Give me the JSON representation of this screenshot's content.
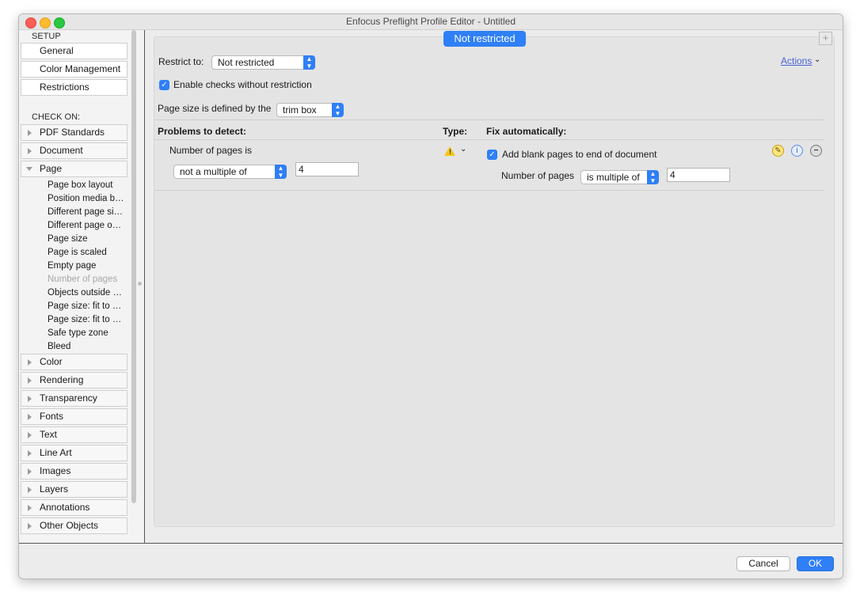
{
  "window": {
    "title": "Enfocus Preflight Profile Editor - Untitled"
  },
  "sidebar": {
    "setup_heading": "SETUP",
    "setup_items": [
      "General",
      "Color Management",
      "Restrictions"
    ],
    "check_on_heading": "CHECK ON:",
    "groups_top": [
      "PDF Standards",
      "Document",
      "Page"
    ],
    "page_subitems": [
      "Page box layout",
      "Position media b…",
      "Different page si…",
      "Different page o…",
      "Page size",
      "Page is scaled",
      "Empty page",
      "Number of pages",
      "Objects outside …",
      "Page size: fit to …",
      "Page size: fit to …",
      "Safe type zone",
      "Bleed"
    ],
    "groups_bottom": [
      "Color",
      "Rendering",
      "Transparency",
      "Fonts",
      "Text",
      "Line Art",
      "Images",
      "Layers",
      "Annotations",
      "Other Objects"
    ]
  },
  "header": {
    "restriction_pill": "Not restricted",
    "restrict_to_label": "Restrict to:",
    "restrict_to_value": "Not restricted",
    "actions_label": "Actions",
    "enable_checks_label": "Enable checks without restriction",
    "page_size_label": "Page size is defined by the",
    "page_size_value": "trim box"
  },
  "columns": {
    "problems": "Problems to detect:",
    "type": "Type:",
    "fix": "Fix automatically:"
  },
  "check": {
    "label": "Number of pages is",
    "condition": "not a multiple of",
    "value": "4"
  },
  "fix": {
    "checkbox_label": "Add blank pages to end of document",
    "pages_label": "Number of pages",
    "condition": "is multiple of",
    "value": "4"
  },
  "buttons": {
    "cancel": "Cancel",
    "ok": "OK"
  },
  "colors": {
    "accent": "#2f7ff6",
    "warning": "#f5c518"
  }
}
